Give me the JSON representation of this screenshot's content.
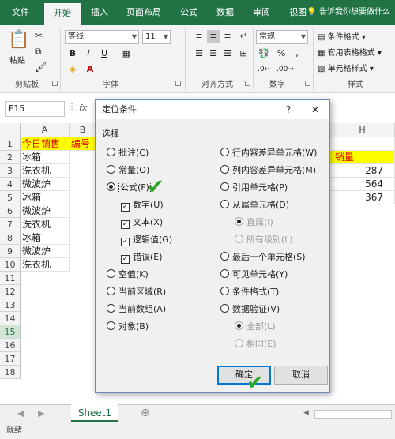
{
  "ribbon_tabs": [
    "文件",
    "开始",
    "插入",
    "页面布局",
    "公式",
    "数据",
    "审阅",
    "视图"
  ],
  "tell_me": "告诉我你想要做什么",
  "clipboard": {
    "paste": "粘贴",
    "label": "剪贴板"
  },
  "font": {
    "name": "等线",
    "size": "11",
    "label": "字体",
    "bold": "B",
    "italic": "I",
    "underline": "U"
  },
  "alignment": {
    "label": "对齐方式"
  },
  "number": {
    "format": "常规",
    "label": "数字",
    "currency": "%",
    "comma": ","
  },
  "styles": {
    "items": [
      "条件格式",
      "套用表格格式",
      "单元格样式"
    ],
    "label": "样式"
  },
  "formula_bar": {
    "name_box": "F15",
    "fx": "fx"
  },
  "columns": [
    "A",
    "B",
    "H"
  ],
  "rows": [
    "1",
    "2",
    "3",
    "4",
    "5",
    "6",
    "7",
    "8",
    "9",
    "10",
    "11",
    "12",
    "13",
    "14",
    "15",
    "16",
    "17",
    "18"
  ],
  "cells": {
    "A": [
      "今日销售",
      "冰箱",
      "洗衣机",
      "微波炉",
      "冰箱",
      "微波炉",
      "洗衣机",
      "冰箱",
      "微波炉",
      "洗衣机"
    ],
    "B1": "编号",
    "H": [
      "",
      "销量",
      "287",
      "564",
      "367"
    ]
  },
  "sheet_tab": "Sheet1",
  "status": "就绪",
  "dialog": {
    "title": "定位条件",
    "help": "?",
    "close": "✕",
    "section": "选择",
    "left": [
      {
        "label": "批注(C)",
        "type": "radio",
        "state": "off"
      },
      {
        "label": "常量(O)",
        "type": "radio",
        "state": "off"
      },
      {
        "label": "公式(F)",
        "type": "radio",
        "state": "on"
      },
      {
        "label": "数字(U)",
        "type": "check",
        "state": "on"
      },
      {
        "label": "文本(X)",
        "type": "check",
        "state": "on"
      },
      {
        "label": "逻辑值(G)",
        "type": "check",
        "state": "on"
      },
      {
        "label": "错误(E)",
        "type": "check",
        "state": "on"
      },
      {
        "label": "空值(K)",
        "type": "radio",
        "state": "off"
      },
      {
        "label": "当前区域(R)",
        "type": "radio",
        "state": "off"
      },
      {
        "label": "当前数组(A)",
        "type": "radio",
        "state": "off"
      },
      {
        "label": "对象(B)",
        "type": "radio",
        "state": "off"
      }
    ],
    "right": [
      {
        "label": "行内容差异单元格(W)",
        "state": "off"
      },
      {
        "label": "列内容差异单元格(M)",
        "state": "off"
      },
      {
        "label": "引用单元格(P)",
        "state": "off"
      },
      {
        "label": "从属单元格(D)",
        "state": "off"
      },
      {
        "label": "直属(I)",
        "state": "dis-on"
      },
      {
        "label": "所有级别(L)",
        "state": "dis"
      },
      {
        "label": "最后一个单元格(S)",
        "state": "off"
      },
      {
        "label": "可见单元格(Y)",
        "state": "off"
      },
      {
        "label": "条件格式(T)",
        "state": "off"
      },
      {
        "label": "数据验证(V)",
        "state": "off"
      },
      {
        "label": "全部(L)",
        "state": "dis-on"
      },
      {
        "label": "相同(E)",
        "state": "dis"
      }
    ],
    "ok": "确定",
    "cancel": "取消"
  }
}
